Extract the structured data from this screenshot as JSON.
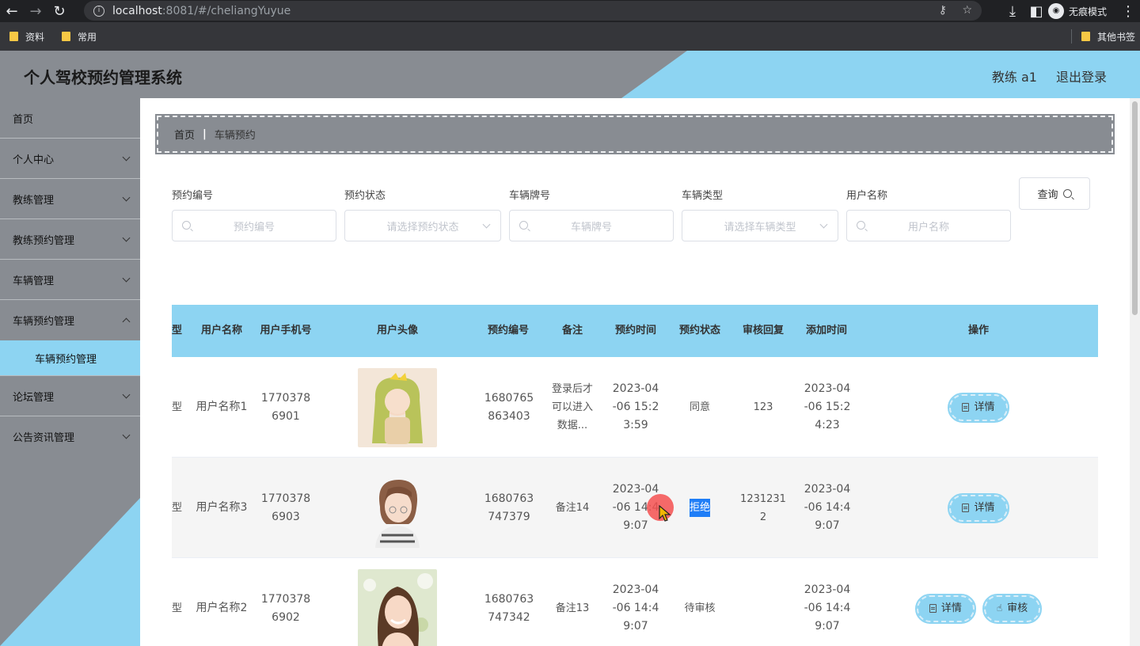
{
  "browser": {
    "url_host": "localhost",
    "url_rest": ":8081/#/cheliangYuyue",
    "incognito_label": "无痕模式",
    "bookmarks": [
      "资料",
      "常用"
    ],
    "other_bookmarks": "其他书签"
  },
  "header": {
    "title": "个人驾校预约管理系统",
    "user": "教练 a1",
    "logout": "退出登录"
  },
  "sidebar": {
    "items": [
      {
        "label": "首页"
      },
      {
        "label": "个人中心"
      },
      {
        "label": "教练管理"
      },
      {
        "label": "教练预约管理"
      },
      {
        "label": "车辆管理"
      },
      {
        "label": "车辆预约管理"
      },
      {
        "label": "车辆预约管理"
      },
      {
        "label": "论坛管理"
      },
      {
        "label": "公告资讯管理"
      }
    ]
  },
  "breadcrumb": {
    "home": "首页",
    "separator": "|",
    "current": "车辆预约"
  },
  "filters": {
    "labels": [
      "预约编号",
      "预约状态",
      "车辆牌号",
      "车辆类型",
      "用户名称"
    ],
    "placeholders": [
      "预约编号",
      "请选择预约状态",
      "车辆牌号",
      "请选择车辆类型",
      "用户名称"
    ],
    "query_button": "查询"
  },
  "table": {
    "headers": [
      "型",
      "用户名称",
      "用户手机号",
      "用户头像",
      "预约编号",
      "备注",
      "预约时间",
      "预约状态",
      "审核回复",
      "添加时间",
      "操作"
    ],
    "rows": [
      {
        "type_tail": "型",
        "user_name": "用户名称1",
        "phone": "17703786901",
        "booking_no": "1680765863403",
        "remark": "登录后才可以进入数据...",
        "booking_time": "2023-04-06 15:23:59",
        "status": "同意",
        "reply": "123",
        "added_time": "2023-04-06 15:24:23",
        "actions": [
          "详情"
        ]
      },
      {
        "type_tail": "型",
        "user_name": "用户名称3",
        "phone": "17703786903",
        "booking_no": "1680763747379",
        "remark": "备注14",
        "booking_time": "2023-04-06 14:49:07",
        "status": "拒绝",
        "reply": "1231231 2",
        "added_time": "2023-04-06 14:49:07",
        "actions": [
          "详情"
        ]
      },
      {
        "type_tail": "型",
        "user_name": "用户名称2",
        "phone": "17703786902",
        "booking_no": "1680763747342",
        "remark": "备注13",
        "booking_time": "2023-04-06 14:49:07",
        "status": "待审核",
        "reply": "",
        "added_time": "2023-04-06 14:49:07",
        "actions": [
          "详情",
          "审核"
        ]
      }
    ]
  },
  "colors": {
    "accent": "#8dd4f2",
    "gray": "#888c92"
  }
}
